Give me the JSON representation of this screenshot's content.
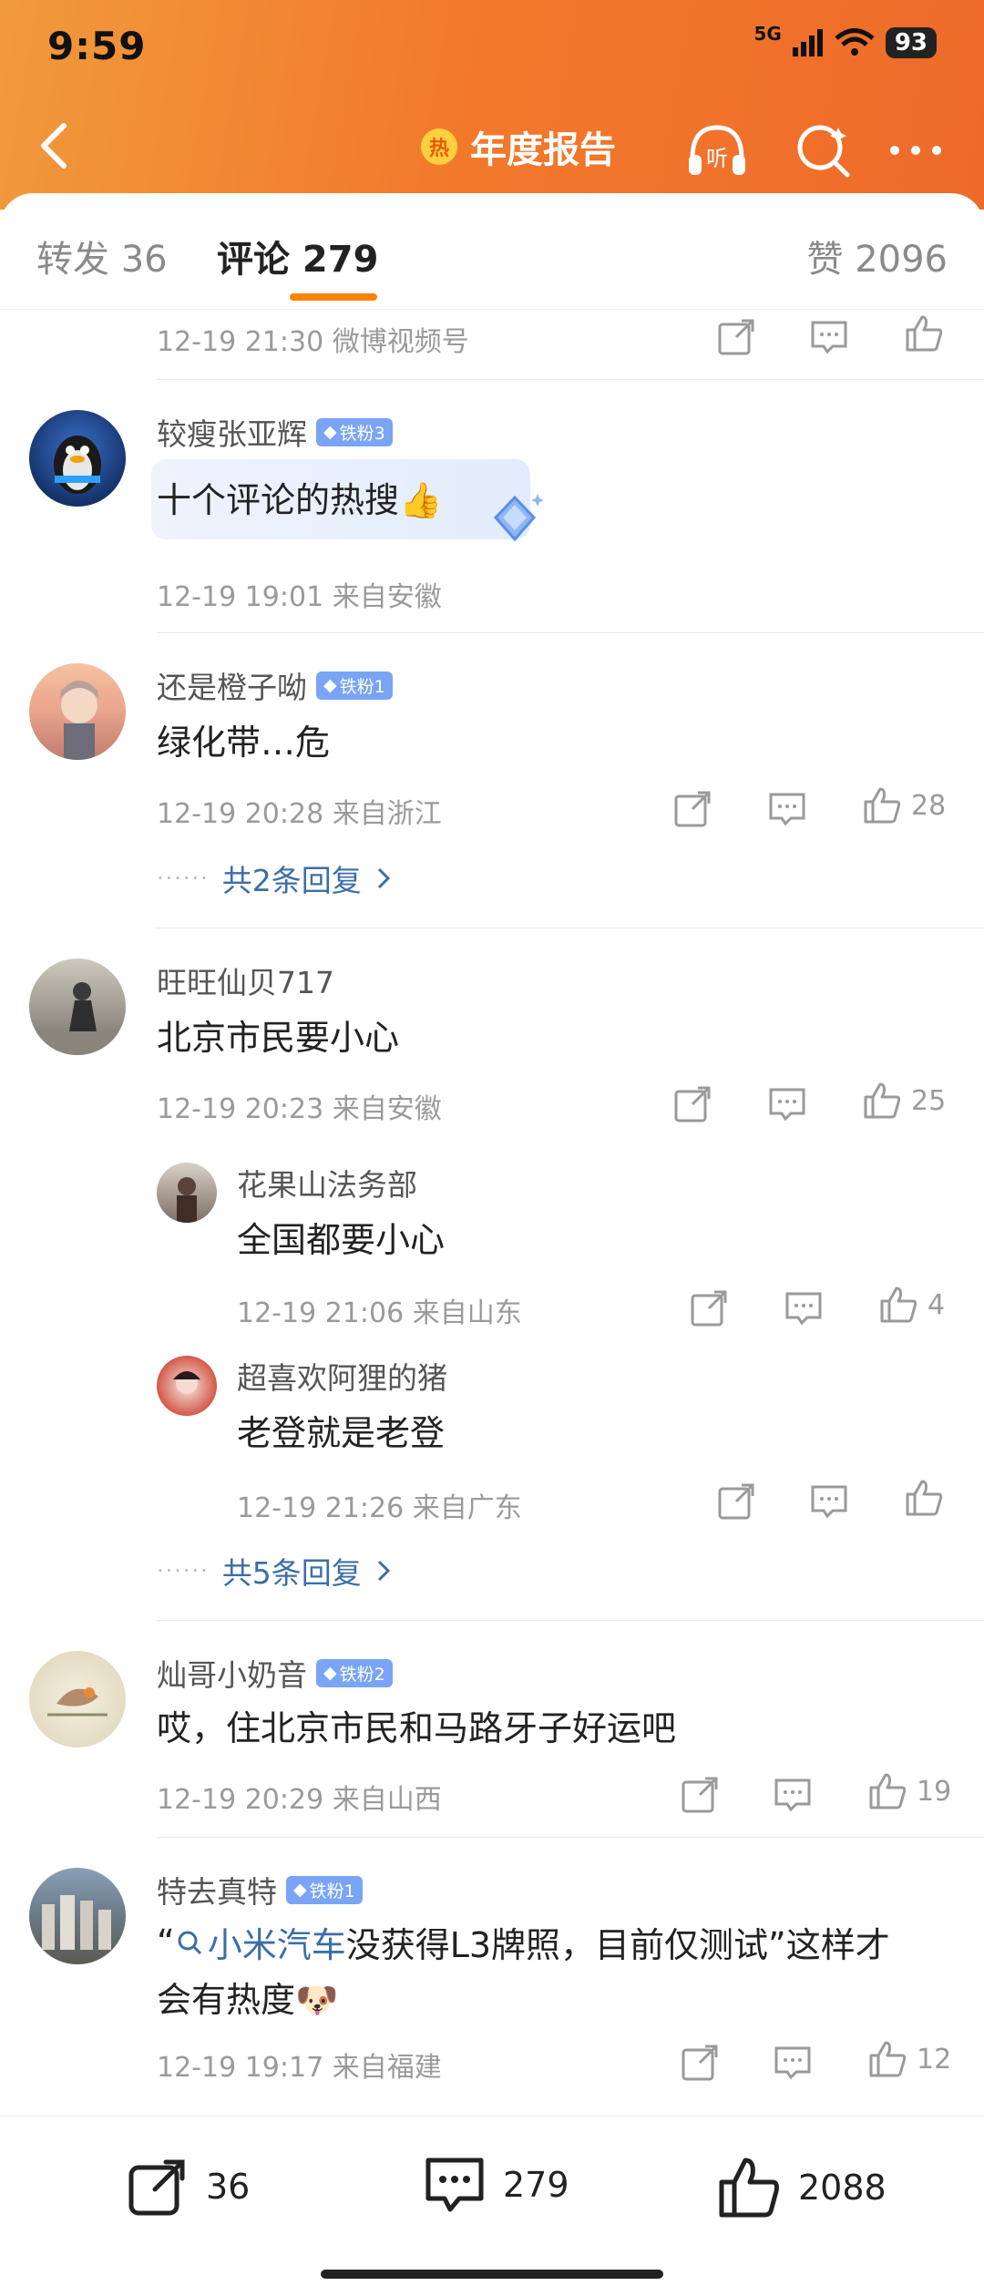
{
  "status_bar": {
    "time": "9:59",
    "network": "5G",
    "battery": "93"
  },
  "nav": {
    "hot_badge": "热",
    "title": "年度报告",
    "listen_label": "听"
  },
  "tabs": [
    {
      "label": "转发 36"
    },
    {
      "label": "评论 279"
    },
    {
      "label": "赞 2096"
    }
  ],
  "top_partial": {
    "meta": "12-19 21:30  微博视频号"
  },
  "comments": [
    {
      "user": "较瘦张亚辉",
      "fan": "铁粉3",
      "text": "十个评论的热搜👍",
      "meta": "12-19 19:01  来自安徽"
    },
    {
      "user": "还是橙子呦",
      "fan": "铁粉1",
      "text": "绿化带…危",
      "meta": "12-19 20:28  来自浙江",
      "likes": "28",
      "replies": "共2条回复"
    },
    {
      "user": "旺旺仙贝717",
      "text": "北京市民要小心",
      "meta": "12-19 20:23  来自安徽",
      "likes": "25",
      "replies": "共5条回复",
      "sub": [
        {
          "user": "花果山法务部",
          "text": "全国都要小心",
          "meta": "12-19 21:06  来自山东",
          "likes": "4"
        },
        {
          "user": "超喜欢阿狸的猪",
          "text": "老登就是老登",
          "meta": "12-19 21:26  来自广东"
        }
      ]
    },
    {
      "user": "灿哥小奶音",
      "fan": "铁粉2",
      "text": "哎，住北京市民和马路牙子好运吧",
      "meta": "12-19 20:29  来自山西",
      "likes": "19"
    },
    {
      "user": "特去真特",
      "fan": "铁粉1",
      "text_open": "“",
      "text_link": "小米汽车",
      "text_rest1": " 没获得L3牌照，目前仅测试”这样才",
      "text_rest2": "会有热度🐶",
      "meta": "12-19 19:17  来自福建",
      "likes": "12"
    }
  ],
  "bottom_bar": {
    "reposts": "36",
    "comments": "279",
    "likes": "2088"
  },
  "colors": {
    "header_start": "#f19a3c",
    "header_end": "#ee6a2a",
    "accent": "#ff8200",
    "link": "#3c6ea8",
    "fan_badge": "#7aa4f5"
  }
}
